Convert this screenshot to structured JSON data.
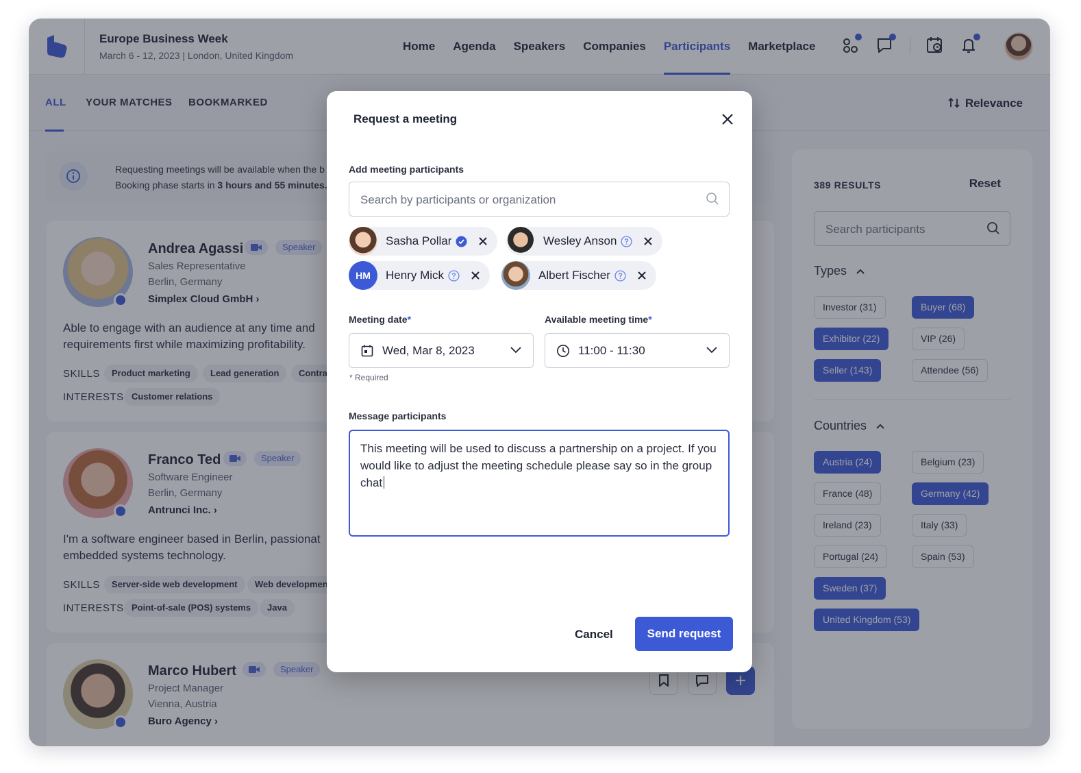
{
  "event": {
    "title": "Europe Business Week",
    "subtitle": "March 6 - 12, 2023 | London, United Kingdom"
  },
  "nav": [
    "Home",
    "Agenda",
    "Speakers",
    "Companies",
    "Participants",
    "Marketplace"
  ],
  "nav_active": "Participants",
  "tabs": {
    "all": "ALL",
    "matches": "YOUR MATCHES",
    "bookmarked": "BOOKMARKED"
  },
  "sort": "Relevance",
  "info": {
    "line1": "Requesting meetings will be available when the b",
    "line2_prefix": "Booking phase starts in ",
    "line2_bold": "3 hours and 55 minutes."
  },
  "people": [
    {
      "name": "Andrea Agassi",
      "badge": "Speaker",
      "role": "Sales Representative",
      "location": "Berlin, Germany",
      "company": "Simplex Cloud GmbH",
      "bio": "Able to engage with an audience at any time and requirements first while maximizing profitability.",
      "skills_label": "SKILLS",
      "skills": [
        "Product marketing",
        "Lead generation",
        "Contra"
      ],
      "interests_label": "INTERESTS",
      "interests": [
        "Customer relations"
      ]
    },
    {
      "name": "Franco Ted",
      "badge": "Speaker",
      "role": "Software Engineer",
      "location": "Berlin, Germany",
      "company": "Antrunci Inc.",
      "bio": "I'm a software engineer based in Berlin, passionat embedded systems technology.",
      "skills_label": "SKILLS",
      "skills": [
        "Server-side web development",
        "Web developmen"
      ],
      "interests_label": "INTERESTS",
      "interests": [
        "Point-of-sale (POS) systems",
        "Java"
      ]
    },
    {
      "name": "Marco Hubert",
      "badge": "Speaker",
      "role": "Project Manager",
      "location": "Vienna, Austria",
      "company": "Buro Agency"
    }
  ],
  "filters": {
    "results": "389 RESULTS",
    "reset": "Reset",
    "search_placeholder": "Search participants",
    "types_label": "Types",
    "types": [
      {
        "label": "Investor (31)",
        "selected": false
      },
      {
        "label": "Buyer (68)",
        "selected": true
      },
      {
        "label": "Exhibitor (22)",
        "selected": true
      },
      {
        "label": "VIP (26)",
        "selected": false
      },
      {
        "label": "Seller (143)",
        "selected": true
      },
      {
        "label": "Attendee (56)",
        "selected": false
      }
    ],
    "countries_label": "Countries",
    "countries": [
      {
        "label": "Austria (24)",
        "selected": true
      },
      {
        "label": "Belgium (23)",
        "selected": false
      },
      {
        "label": "France (48)",
        "selected": false
      },
      {
        "label": "Germany (42)",
        "selected": true
      },
      {
        "label": "Ireland (23)",
        "selected": false
      },
      {
        "label": "Italy (33)",
        "selected": false
      },
      {
        "label": "Portugal (24)",
        "selected": false
      },
      {
        "label": "Spain (53)",
        "selected": false
      },
      {
        "label": "Sweden (37)",
        "selected": true
      },
      {
        "label": "United Kingdom (53)",
        "selected": true
      }
    ]
  },
  "modal": {
    "title": "Request a meeting",
    "participants_label": "Add meeting participants",
    "search_placeholder": "Search by participants or organization",
    "chips": [
      {
        "name": "Sasha Pollar",
        "verified": true
      },
      {
        "name": "Wesley Anson",
        "verified": false
      },
      {
        "name": "Henry Mick",
        "initials": "HM",
        "verified": false
      },
      {
        "name": "Albert Fischer",
        "verified": false
      }
    ],
    "date_label": "Meeting date",
    "date_value": "Wed, Mar 8, 2023",
    "time_label": "Available meeting time",
    "time_value": "11:00 - 11:30",
    "required_note": "* Required",
    "message_label": "Message participants",
    "message": "This meeting will be used to discuss a partnership on a project. If you would like to adjust the meeting schedule please say so in the group chat",
    "cancel": "Cancel",
    "send": "Send request"
  },
  "colors": {
    "accent": "#3d5ad6"
  }
}
